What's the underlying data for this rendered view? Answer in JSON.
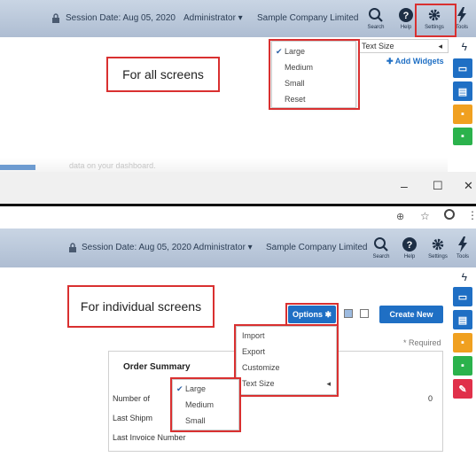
{
  "top": {
    "session": "Session Date: Aug 05, 2020",
    "user": "Administrator",
    "company": "Sample Company Limited",
    "search_label": "Search",
    "help_label": "Help",
    "settings_label": "Settings",
    "tools_label": "Tools",
    "text_size_label": "Text Size",
    "add_widgets": "Add Widgets",
    "size_menu": [
      "Large",
      "Medium",
      "Small",
      "Reset"
    ],
    "callout": "For all screens",
    "faded_text": "data on your dashboard."
  },
  "bottom": {
    "session": "Session Date: Aug 05, 2020",
    "user": "Administrator",
    "company": "Sample Company Limited",
    "search_label": "Search",
    "help_label": "Help",
    "settings_label": "Settings",
    "tools_label": "Tools",
    "callout": "For individual screens",
    "options_label": "Options",
    "create_new": "Create New",
    "required": "* Required",
    "options_menu": [
      "Import",
      "Export",
      "Customize",
      "Text Size"
    ],
    "size_menu": [
      "Large",
      "Medium",
      "Small"
    ],
    "card_title": "Order Summary",
    "row1_label": "Number of",
    "row1_value": "0",
    "row2_label": "Last Shipm",
    "row3_label": "Last Invoice Number"
  },
  "window": {
    "minimize": "–",
    "maximize": "☐",
    "close": "✕"
  },
  "colors": {
    "accent": "#1f6fc4",
    "highlight": "#d93030",
    "topbar": "#bccadb"
  }
}
